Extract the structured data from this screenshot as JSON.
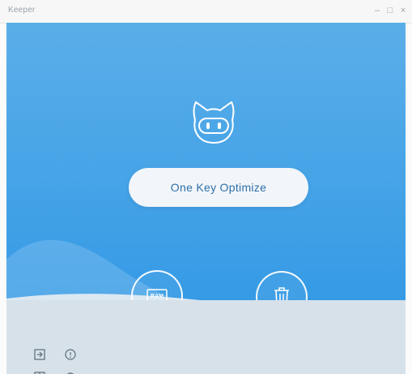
{
  "window": {
    "title": "Keeper",
    "controls": [
      "minimize-icon",
      "maximize-icon",
      "close-icon"
    ]
  },
  "main": {
    "mascot_icon": "robot-cat-icon",
    "optimize_button_label": "One Key Optimize",
    "tools": [
      {
        "name": "ram-optimize",
        "icon": "ram-chip-icon",
        "chip_label": "RAM"
      },
      {
        "name": "trash-clean",
        "icon": "trash-icon"
      }
    ]
  },
  "footer": {
    "icons": [
      "exit-icon",
      "info-icon",
      "grid-icon",
      "settings-icon"
    ]
  },
  "colors": {
    "background_top": "#5aaee8",
    "background_bottom": "#2e96e4",
    "button_text": "#2e6fa8",
    "footer": "#d7e1ea"
  }
}
